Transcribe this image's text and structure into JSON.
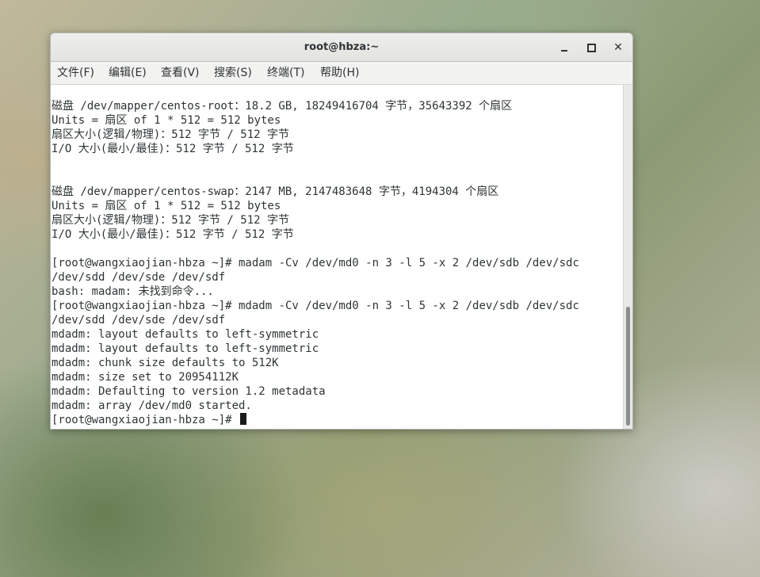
{
  "window": {
    "title": "root@hbza:~",
    "close_symbol": "✕"
  },
  "menubar": {
    "items": [
      "文件(F)",
      "编辑(E)",
      "查看(V)",
      "搜索(S)",
      "终端(T)",
      "帮助(H)"
    ]
  },
  "terminal": {
    "lines": [
      "磁盘 /dev/mapper/centos-root：18.2 GB, 18249416704 字节，35643392 个扇区",
      "Units = 扇区 of 1 * 512 = 512 bytes",
      "扇区大小(逻辑/物理)：512 字节 / 512 字节",
      "I/O 大小(最小/最佳)：512 字节 / 512 字节",
      "",
      "",
      "磁盘 /dev/mapper/centos-swap：2147 MB, 2147483648 字节，4194304 个扇区",
      "Units = 扇区 of 1 * 512 = 512 bytes",
      "扇区大小(逻辑/物理)：512 字节 / 512 字节",
      "I/O 大小(最小/最佳)：512 字节 / 512 字节",
      "",
      "[root@wangxiaojian-hbza ~]# madam -Cv /dev/md0 -n 3 -l 5 -x 2 /dev/sdb /dev/sdc",
      "/dev/sdd /dev/sde /dev/sdf",
      "bash: madam: 未找到命令...",
      "[root@wangxiaojian-hbza ~]# mdadm -Cv /dev/md0 -n 3 -l 5 -x 2 /dev/sdb /dev/sdc",
      "/dev/sdd /dev/sde /dev/sdf",
      "mdadm: layout defaults to left-symmetric",
      "mdadm: layout defaults to left-symmetric",
      "mdadm: chunk size defaults to 512K",
      "mdadm: size set to 20954112K",
      "mdadm: Defaulting to version 1.2 metadata",
      "mdadm: array /dev/md0 started.",
      "[root@wangxiaojian-hbza ~]# "
    ]
  }
}
